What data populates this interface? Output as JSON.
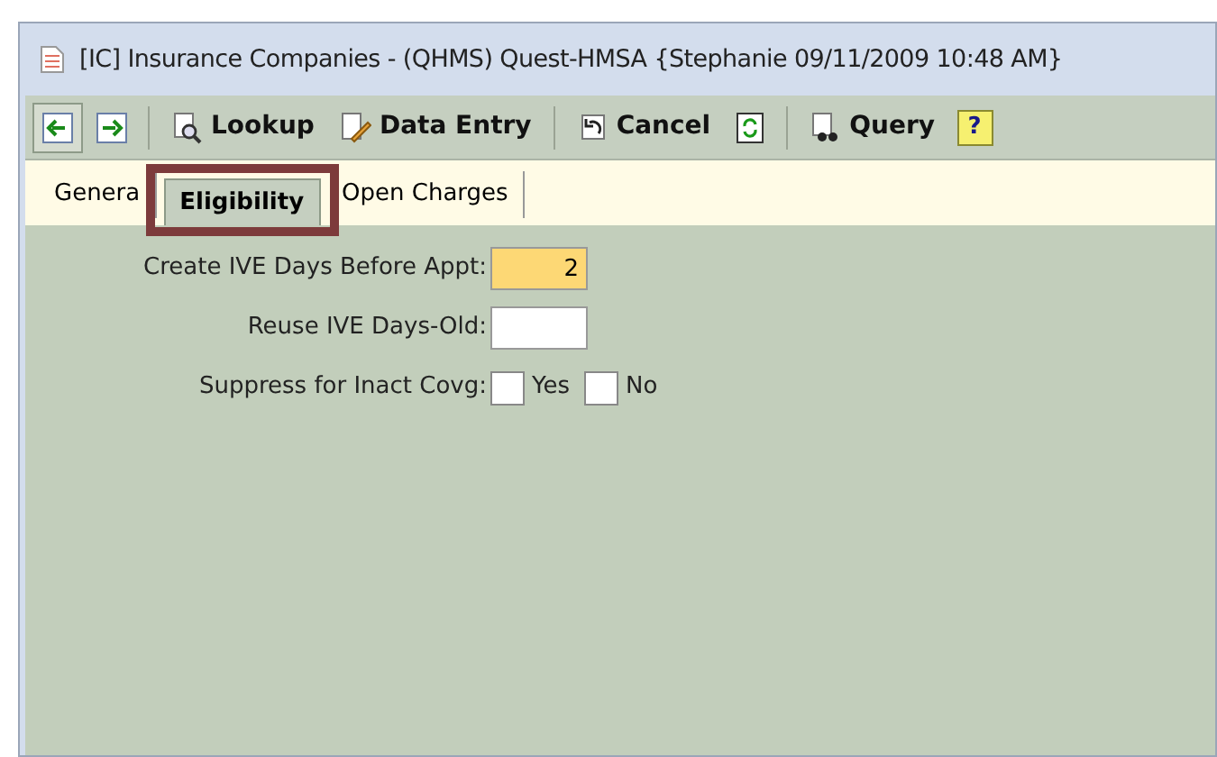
{
  "window": {
    "title": "[IC] Insurance Companies - (QHMS) Quest-HMSA {Stephanie 09/11/2009 10:48 AM}"
  },
  "toolbar": [
    {
      "kind": "icon",
      "pressed": true
    },
    {
      "kind": "icon",
      "pressed": false
    },
    {
      "kind": "separator"
    },
    {
      "kind": "button",
      "label": "Lookup"
    },
    {
      "kind": "button",
      "label": "Data Entry"
    },
    {
      "kind": "separator"
    },
    {
      "kind": "button",
      "label": "Cancel"
    },
    {
      "kind": "icon",
      "pressed": false
    },
    {
      "kind": "separator"
    },
    {
      "kind": "button",
      "label": "Query"
    },
    {
      "kind": "help",
      "label": "?"
    }
  ],
  "tabs": [
    {
      "label": "Genera",
      "selected": false
    },
    {
      "label": "Eligibility",
      "selected": true,
      "highlighted": true
    },
    {
      "label": "Open Charges",
      "selected": false
    }
  ],
  "fields": [
    {
      "kind": "text",
      "label": "Create IVE Days Before Appt:",
      "value": "2",
      "focused": true
    },
    {
      "kind": "text",
      "label": "Reuse IVE Days-Old:",
      "focused": false
    },
    {
      "kind": "checks",
      "label": "Suppress for Inact Covg:",
      "options": [
        {
          "label": "Yes",
          "checked": false
        },
        {
          "label": "No",
          "checked": false
        }
      ]
    }
  ]
}
